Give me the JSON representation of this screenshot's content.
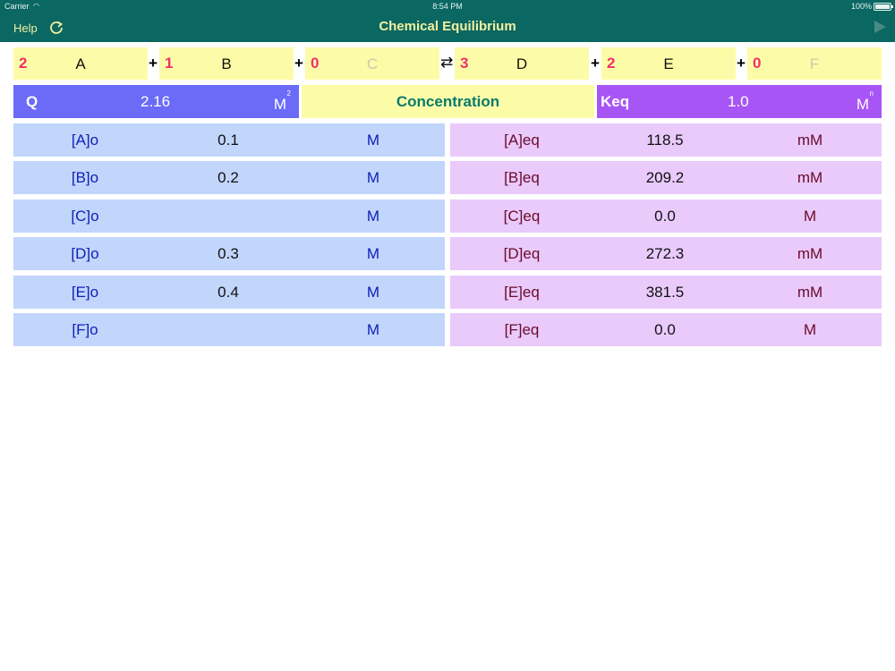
{
  "status": {
    "carrier": "Carrier",
    "time": "8:54 PM",
    "battery": "100%"
  },
  "nav": {
    "help": "Help",
    "title": "Chemical Equilibrium",
    "refresh_icon": "refresh-icon",
    "play_icon": "play-icon"
  },
  "equation": {
    "reactants": [
      {
        "coef": "2",
        "species": "A",
        "active": true
      },
      {
        "coef": "1",
        "species": "B",
        "active": true
      },
      {
        "coef": "0",
        "species": "C",
        "active": false
      }
    ],
    "products": [
      {
        "coef": "3",
        "species": "D",
        "active": true
      },
      {
        "coef": "2",
        "species": "E",
        "active": true
      },
      {
        "coef": "0",
        "species": "F",
        "active": false
      }
    ],
    "plus": "+",
    "arrow": "⇄"
  },
  "q": {
    "label": "Q",
    "value": "2.16",
    "unit": "M",
    "exponent": "2"
  },
  "concentration": {
    "label": "Concentration"
  },
  "keq": {
    "label": "Keq",
    "value": "1.0",
    "unit": "M",
    "exponent": "n"
  },
  "initial": [
    {
      "name": "[A]o",
      "value": "0.1",
      "unit": "M"
    },
    {
      "name": "[B]o",
      "value": "0.2",
      "unit": "M"
    },
    {
      "name": "[C]o",
      "value": "",
      "unit": "M"
    },
    {
      "name": "[D]o",
      "value": "0.3",
      "unit": "M"
    },
    {
      "name": "[E]o",
      "value": "0.4",
      "unit": "M"
    },
    {
      "name": "[F]o",
      "value": "",
      "unit": "M"
    }
  ],
  "equilibrium": [
    {
      "name": "[A]eq",
      "value": "118.5",
      "unit": "mM"
    },
    {
      "name": "[B]eq",
      "value": "209.2",
      "unit": "mM"
    },
    {
      "name": "[C]eq",
      "value": "0.0",
      "unit": "M"
    },
    {
      "name": "[D]eq",
      "value": "272.3",
      "unit": "mM"
    },
    {
      "name": "[E]eq",
      "value": "381.5",
      "unit": "mM"
    },
    {
      "name": "[F]eq",
      "value": "0.0",
      "unit": "M"
    }
  ],
  "colors": {
    "nav": "#0a6762",
    "accent_yellow": "#f4f0a0",
    "coef": "#f0306a",
    "q": "#6b6bf8",
    "keq": "#a855f5"
  }
}
